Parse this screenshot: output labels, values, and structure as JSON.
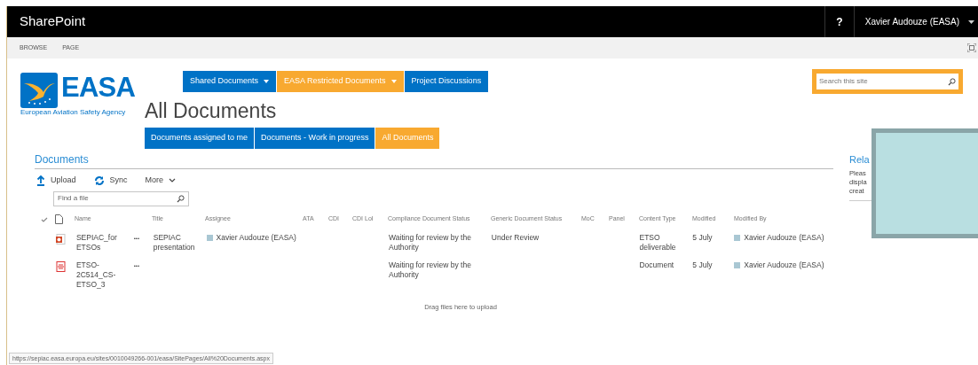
{
  "topbar": {
    "brand": "SharePoint",
    "help": "?",
    "user": "Xavier Audouze (EASA)"
  },
  "ribbon_tabs": [
    "BROWSE",
    "PAGE"
  ],
  "logo": {
    "text": "EASA",
    "tagline": "European Aviation Safety Agency"
  },
  "nav": [
    {
      "label": "Shared Documents",
      "color": "#0072c6",
      "dropdown": true
    },
    {
      "label": "EASA Restricted Documents",
      "color": "#f8a930",
      "dropdown": true
    },
    {
      "label": "Project Discussions",
      "color": "#0072c6",
      "dropdown": false
    }
  ],
  "search": {
    "placeholder": "Search this site"
  },
  "page_title": "All Documents",
  "views": [
    {
      "label": "Documents assigned to me",
      "selected": false
    },
    {
      "label": "Documents - Work in progress",
      "selected": false
    },
    {
      "label": "All Documents",
      "selected": true
    }
  ],
  "section_heading": "Documents",
  "commands": [
    {
      "kind": "upload",
      "label": "Upload"
    },
    {
      "kind": "sync",
      "label": "Sync"
    },
    {
      "kind": "more",
      "label": "More"
    }
  ],
  "find": {
    "placeholder": "Find a file"
  },
  "columns": [
    "Name",
    "Title",
    "Assignee",
    "ATA",
    "CDI",
    "CDI LoI",
    "Compliance Document Status",
    "Generic Document Status",
    "MoC",
    "Panel",
    "Content Type",
    "Modified",
    "Modified By"
  ],
  "rows": [
    {
      "kind": "slides",
      "name": "SEPIAC_for ETSOs",
      "more": "•••",
      "title": "SEPIAC presentation",
      "assignee": "Xavier Audouze (EASA)",
      "compliance": "Waiting for review by the Authority",
      "generic": "Under Review",
      "content_type": "ETSO deliverable",
      "modified": "5 July",
      "modified_by": "Xavier Audouze (EASA)"
    },
    {
      "kind": "pdf",
      "name": "ETSO-2C514_CS-ETSO_3",
      "more": "•••",
      "compliance": "Waiting for review by the Authority",
      "content_type": "Document",
      "modified": "5 July",
      "modified_by": "Xavier Audouze (EASA)"
    }
  ],
  "drop_hint": "Drag files here to upload",
  "right_panel": {
    "heading": "Rela",
    "lines": [
      "Pleas",
      "displa",
      "creat"
    ]
  },
  "status_url": "https://sepiac.easa.europa.eu/sites/0010049266-001/easa/SitePages/All%20Documents.aspx"
}
